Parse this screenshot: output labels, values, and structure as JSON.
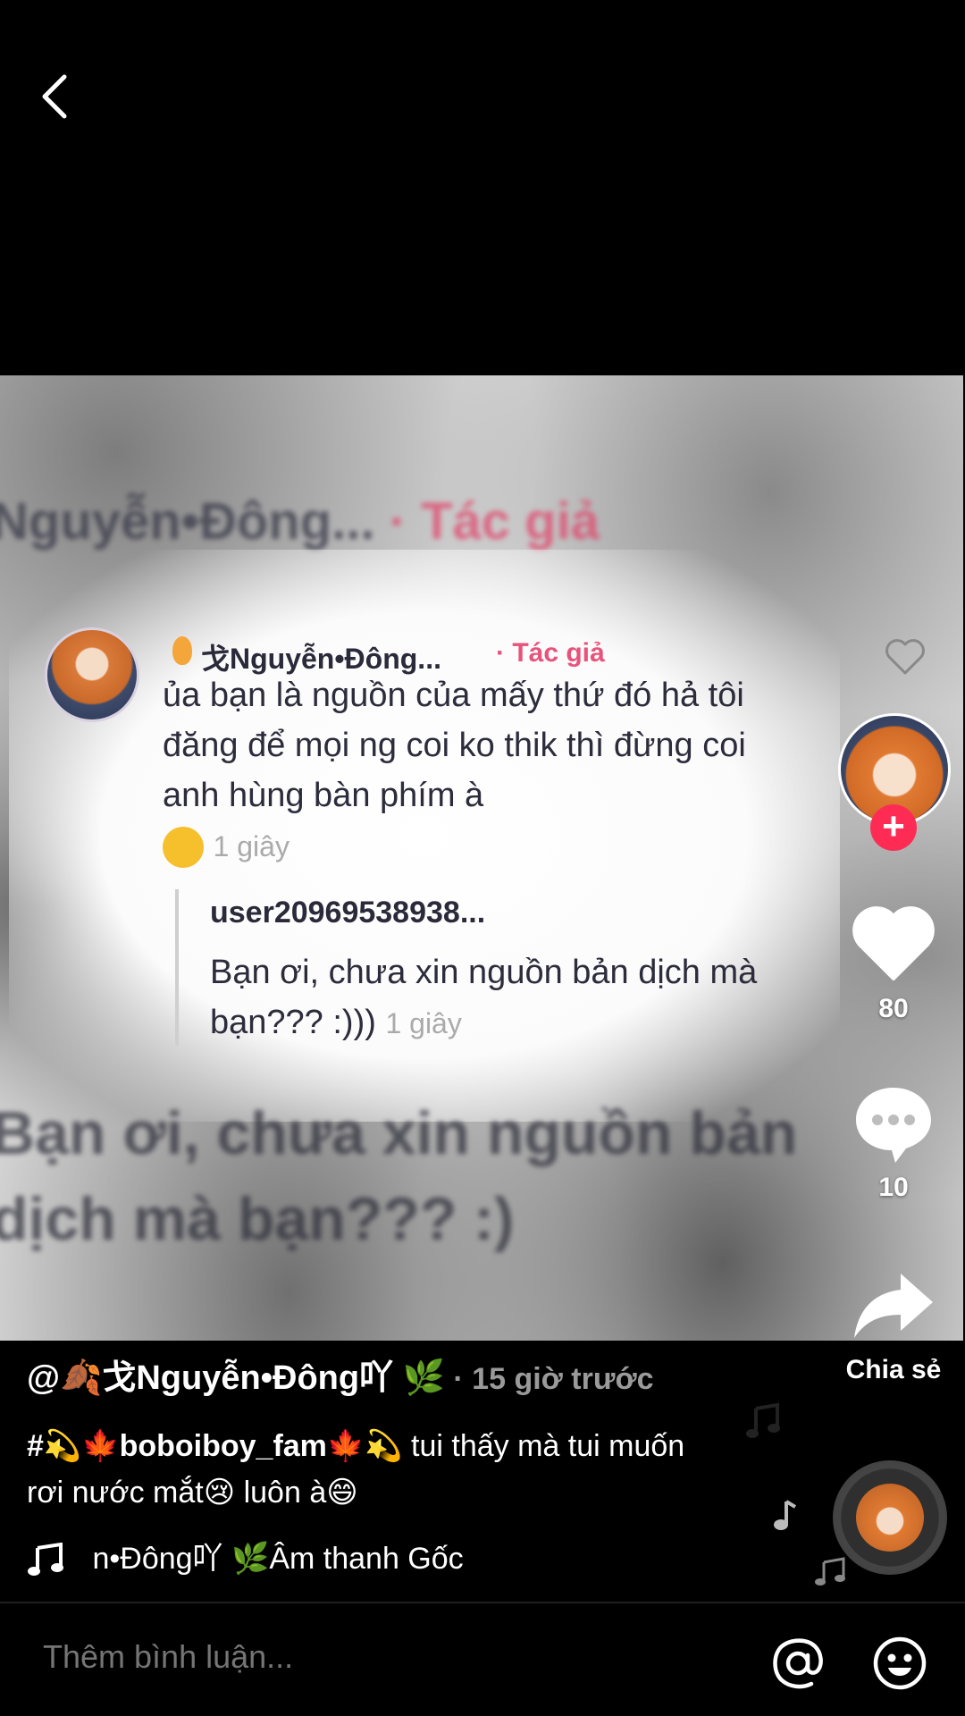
{
  "video": {
    "overlay_top_author": "Nguyễn•Đông...",
    "overlay_top_tag": "Tác giả",
    "comment": {
      "author": "戈Nguyễn•Đông...",
      "author_tag": "· Tác giả",
      "text": "ủa bạn là nguồn của mấy thứ đó hả tôi đăng để mọi ng coi ko thik thì đừng coi anh hùng bàn phím à",
      "time": "1 giây"
    },
    "reply": {
      "author": "user20969538938...",
      "text": "Bạn ơi, chưa xin nguồn bản dịch mà bạn??? :)))",
      "time": "1 giây"
    },
    "overlay_bottom_text": "Bạn ơi, chưa xin nguồn bản dịch mà bạn??? :)"
  },
  "actions": {
    "likes": "80",
    "comments": "10",
    "share_label": "Chia sẻ"
  },
  "caption": {
    "username": "@🍂戈Nguyễn•Đông吖 🌿",
    "time": " · 15 giờ trước",
    "hashtag": "#💫🍁boboiboy_fam🍁💫",
    "text": " tui thấy mà tui muốn rơi nước mắt😢 luôn à😄",
    "music": "n•Đông吖 🌿Âm thanh Gốc"
  },
  "comment_box": {
    "placeholder": "Thêm bình luận..."
  },
  "colors": {
    "accent": "#fe2c55",
    "author_tag": "#e8537c",
    "background": "#000000"
  }
}
